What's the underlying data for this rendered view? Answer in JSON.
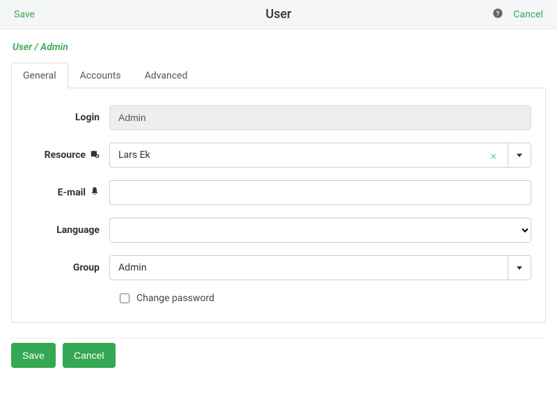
{
  "topbar": {
    "save": "Save",
    "title": "User",
    "cancel": "Cancel"
  },
  "breadcrumb": "User / Admin",
  "tabs": {
    "general": "General",
    "accounts": "Accounts",
    "advanced": "Advanced"
  },
  "form": {
    "login": {
      "label": "Login",
      "value": "Admin"
    },
    "resource": {
      "label": "Resource",
      "value": "Lars Ek"
    },
    "email": {
      "label": "E-mail",
      "value": ""
    },
    "language": {
      "label": "Language",
      "value": ""
    },
    "group": {
      "label": "Group",
      "value": "Admin"
    },
    "change_password": {
      "label": "Change password",
      "checked": false
    }
  },
  "footer": {
    "save": "Save",
    "cancel": "Cancel"
  }
}
